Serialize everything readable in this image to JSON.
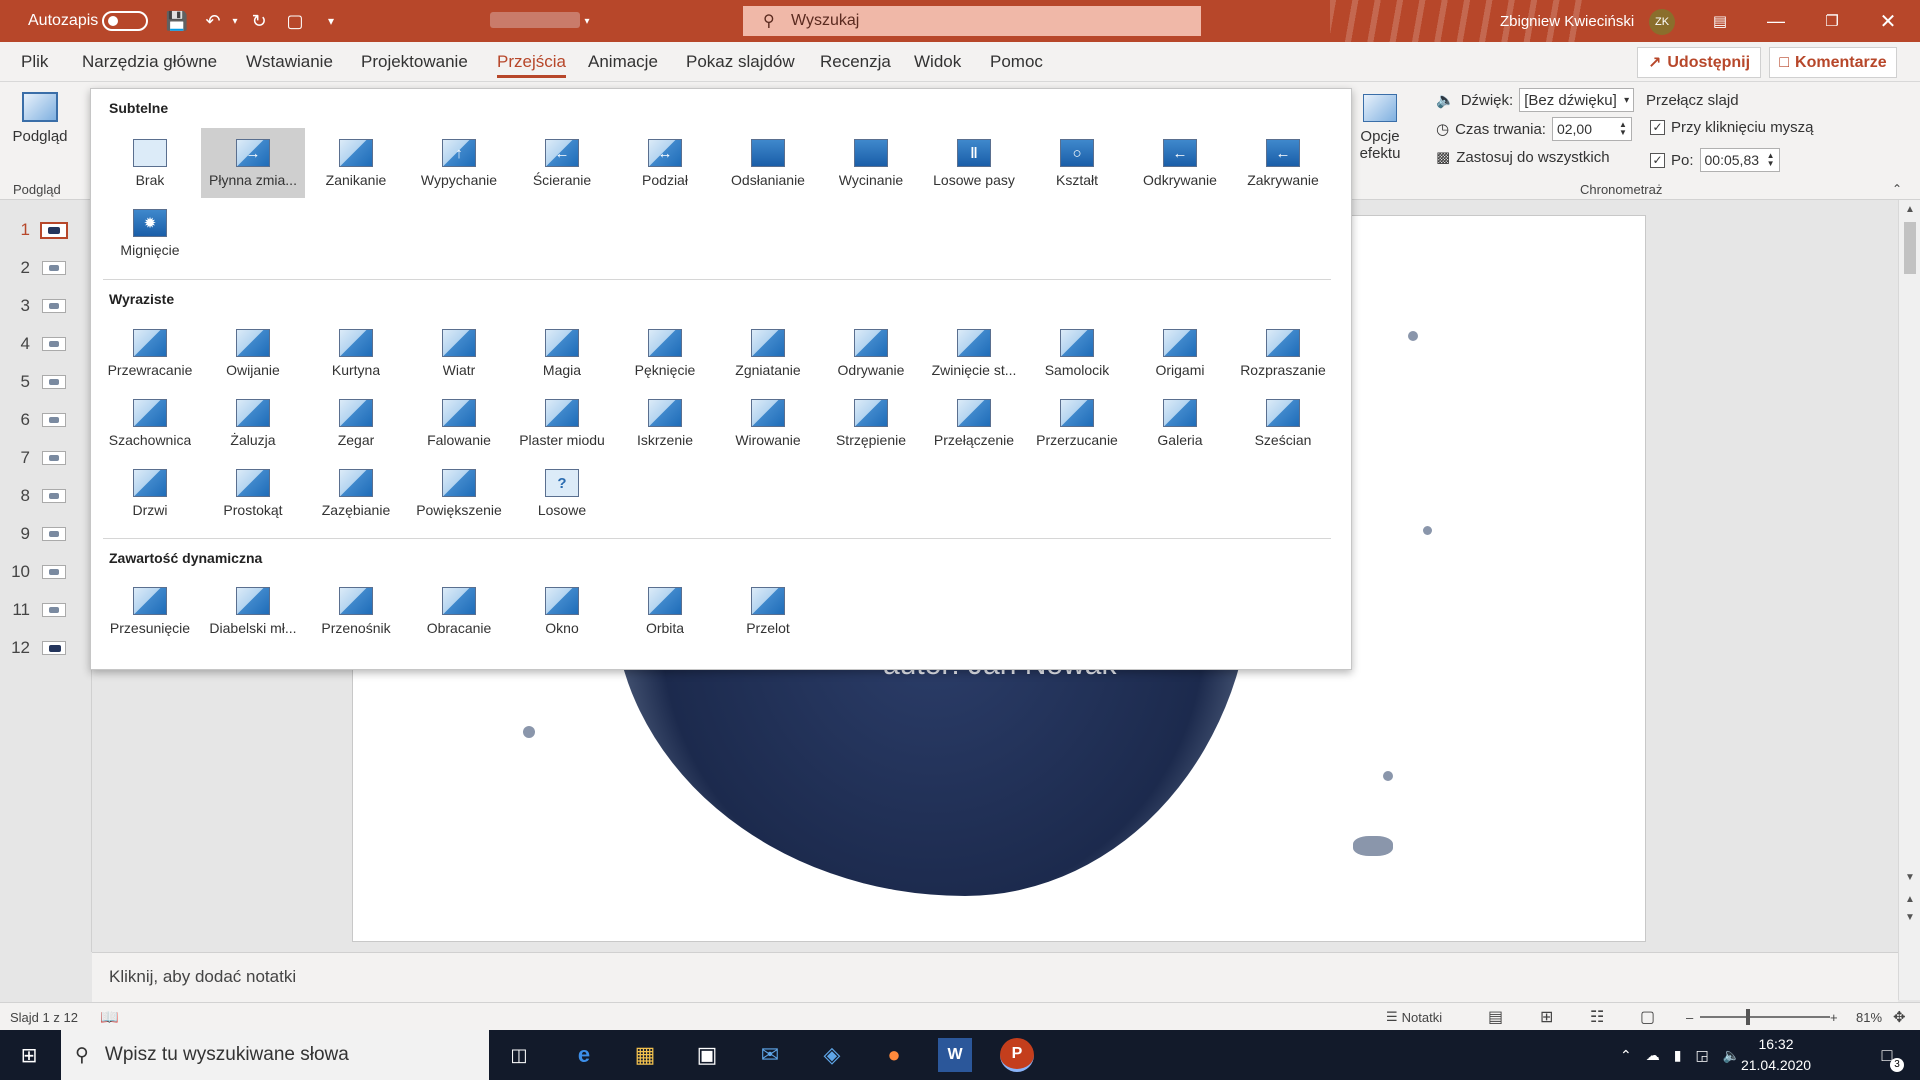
{
  "titlebar": {
    "autosave_label": "Autozapis",
    "search_placeholder": "Wyszukaj",
    "user_name": "Zbigniew Kwieciński",
    "user_initials": "ZK",
    "accent": "#b7472a"
  },
  "menu": {
    "tabs": [
      "Plik",
      "Narzędzia główne",
      "Wstawianie",
      "Projektowanie",
      "Przejścia",
      "Animacje",
      "Pokaz slajdów",
      "Recenzja",
      "Widok",
      "Pomoc"
    ],
    "active_tab": "Przejścia",
    "share_label": "Udostępnij",
    "comments_label": "Komentarze"
  },
  "ribbon": {
    "preview_label": "Podgląd",
    "preview_group_label": "Podgląd",
    "effect_options_line1": "Opcje",
    "effect_options_line2": "efektu",
    "sound_label": "Dźwięk:",
    "sound_value": "[Bez dźwięku]",
    "duration_label": "Czas trwania:",
    "duration_value": "02,00",
    "apply_all_label": "Zastosuj do wszystkich",
    "advance_label": "Przełącz slajd",
    "on_click_label": "Przy kliknięciu myszą",
    "after_label": "Po:",
    "after_value": "00:05,83",
    "timing_group_label": "Chronometraż"
  },
  "gallery": {
    "sections": [
      {
        "title": "Subtelne",
        "items": [
          "Brak",
          "Płynna zmia...",
          "Zanikanie",
          "Wypychanie",
          "Ścieranie",
          "Podział",
          "Odsłanianie",
          "Wycinanie",
          "Losowe pasy",
          "Kształt",
          "Odkrywanie",
          "Zakrywanie",
          "Mignięcie"
        ]
      },
      {
        "title": "Wyraziste",
        "items": [
          "Przewracanie",
          "Owijanie",
          "Kurtyna",
          "Wiatr",
          "Magia",
          "Pęknięcie",
          "Zgniatanie",
          "Odrywanie",
          "Zwinięcie st...",
          "Samolocik",
          "Origami",
          "Rozpraszanie",
          "Szachownica",
          "Żaluzja",
          "Zegar",
          "Falowanie",
          "Plaster miodu",
          "Iskrzenie",
          "Wirowanie",
          "Strzępienie",
          "Przełączenie",
          "Przerzucanie",
          "Galeria",
          "Sześcian",
          "Drzwi",
          "Prostokąt",
          "Zazębianie",
          "Powiększenie",
          "Losowe"
        ]
      },
      {
        "title": "Zawartość dynamiczna",
        "items": [
          "Przesunięcie",
          "Diabelski mł...",
          "Przenośnik",
          "Obracanie",
          "Okno",
          "Orbita",
          "Przelot"
        ]
      }
    ],
    "selected_item": "Płynna zmia..."
  },
  "slides": {
    "numbers": [
      "1",
      "2",
      "3",
      "4",
      "5",
      "6",
      "7",
      "8",
      "9",
      "10",
      "11",
      "12"
    ],
    "selected": 1,
    "subtitle_visible": "autor: Jan Nowak"
  },
  "notes": {
    "placeholder": "Kliknij, aby dodać notatki"
  },
  "statusbar": {
    "slide_info": "Slajd 1 z 12",
    "notes_label": "Notatki",
    "zoom": "81%"
  },
  "taskbar": {
    "search_placeholder": "Wpisz tu wyszukiwane słowa",
    "time": "16:32",
    "date": "21.04.2020",
    "notification_count": "3"
  }
}
